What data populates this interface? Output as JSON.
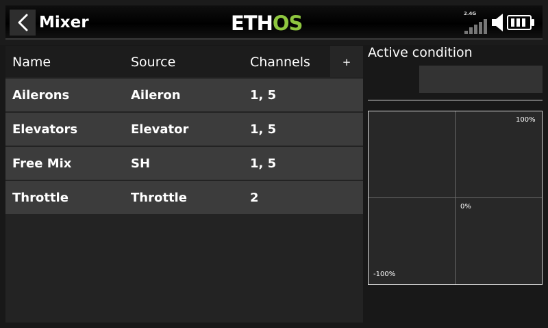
{
  "header": {
    "title": "Mixer",
    "logo_left": "ETH",
    "logo_right": "OS",
    "rf_band": "2.4G"
  },
  "table": {
    "columns": [
      "Name",
      "Source",
      "Channels"
    ],
    "add_label": "+",
    "rows": [
      {
        "name": "Ailerons",
        "source": "Aileron",
        "channels": "1, 5"
      },
      {
        "name": "Elevators",
        "source": "Elevator",
        "channels": "1, 5"
      },
      {
        "name": "Free Mix",
        "source": "SH",
        "channels": "1, 5"
      },
      {
        "name": "Throttle",
        "source": "Throttle",
        "channels": "2"
      }
    ]
  },
  "panel": {
    "active_condition_label": "Active condition",
    "active_condition_value": "",
    "graph": {
      "top_label": "100%",
      "center_label": "0%",
      "bottom_label": "-100%"
    }
  },
  "colors": {
    "logo_accent": "#8ec63f",
    "row_bg": "#3c3c3c",
    "table_bg": "#232323"
  },
  "icons": {
    "back": "chevron-left-icon",
    "signal": "signal-bars-icon",
    "volume": "speaker-icon",
    "battery": "battery-icon"
  }
}
